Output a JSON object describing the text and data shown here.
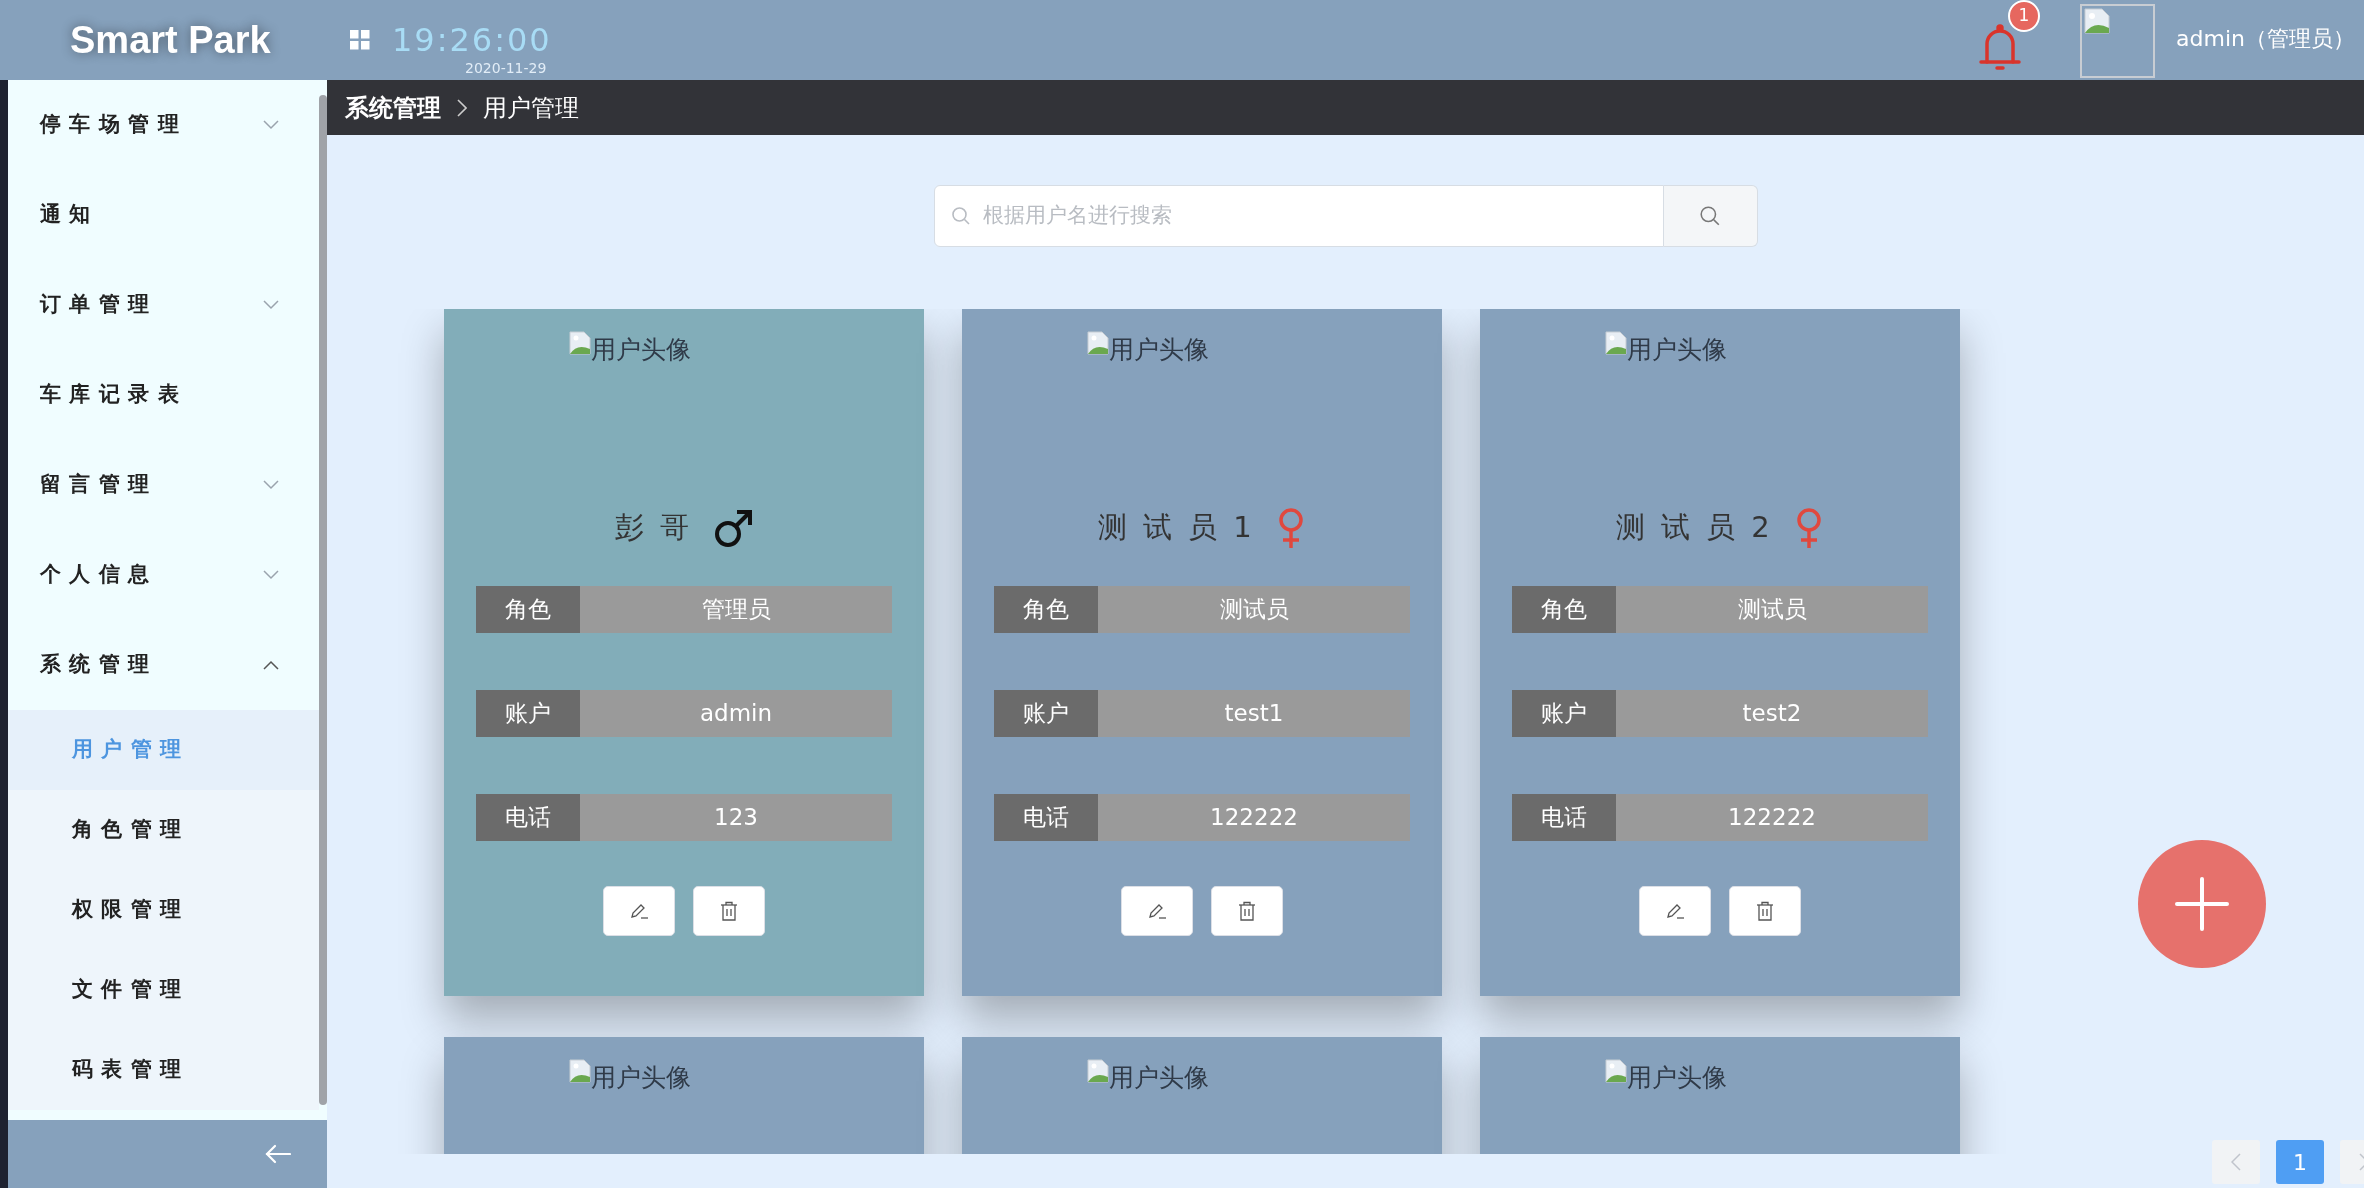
{
  "header": {
    "logo": "Smart Park",
    "time": "19:26:00",
    "date": "2020-11-29",
    "notifications": "1",
    "user": "admin（管理员）"
  },
  "sidebar": {
    "items": [
      {
        "label": "停车场管理",
        "kind": "group",
        "expanded": false
      },
      {
        "label": "通知",
        "kind": "link"
      },
      {
        "label": "订单管理",
        "kind": "group",
        "expanded": false
      },
      {
        "label": "车库记录表",
        "kind": "link"
      },
      {
        "label": "留言管理",
        "kind": "group",
        "expanded": false
      },
      {
        "label": "个人信息",
        "kind": "group",
        "expanded": false
      },
      {
        "label": "系统管理",
        "kind": "group",
        "expanded": true,
        "children": [
          {
            "label": "用户管理",
            "selected": true
          },
          {
            "label": "角色管理",
            "selected": false
          },
          {
            "label": "权限管理",
            "selected": false
          },
          {
            "label": "文件管理",
            "selected": false
          },
          {
            "label": "码表管理",
            "selected": false
          }
        ]
      }
    ]
  },
  "breadcrumb": [
    "系统管理",
    "用户管理"
  ],
  "search": {
    "placeholder": "根据用户名进行搜索"
  },
  "cards": [
    {
      "avatar_alt": "用户头像",
      "name": "彭哥",
      "kind": "male",
      "selected": true,
      "fields": [
        {
          "label": "角色",
          "value": "管理员"
        },
        {
          "label": "账户",
          "value": "admin"
        },
        {
          "label": "电话",
          "value": "123"
        }
      ]
    },
    {
      "avatar_alt": "用户头像",
      "name": "测试员1",
      "kind": "female",
      "selected": false,
      "fields": [
        {
          "label": "角色",
          "value": "测试员"
        },
        {
          "label": "账户",
          "value": "test1"
        },
        {
          "label": "电话",
          "value": "122222"
        }
      ]
    },
    {
      "avatar_alt": "用户头像",
      "name": "测试员2",
      "kind": "female",
      "selected": false,
      "fields": [
        {
          "label": "角色",
          "value": "测试员"
        },
        {
          "label": "账户",
          "value": "test2"
        },
        {
          "label": "电话",
          "value": "122222"
        }
      ]
    },
    {
      "avatar_alt": "用户头像",
      "selected": false
    },
    {
      "avatar_alt": "用户头像",
      "selected": false
    },
    {
      "avatar_alt": "用户头像",
      "selected": false
    }
  ],
  "pagination": {
    "pages": [
      {
        "label": "1",
        "selected": true
      }
    ]
  }
}
